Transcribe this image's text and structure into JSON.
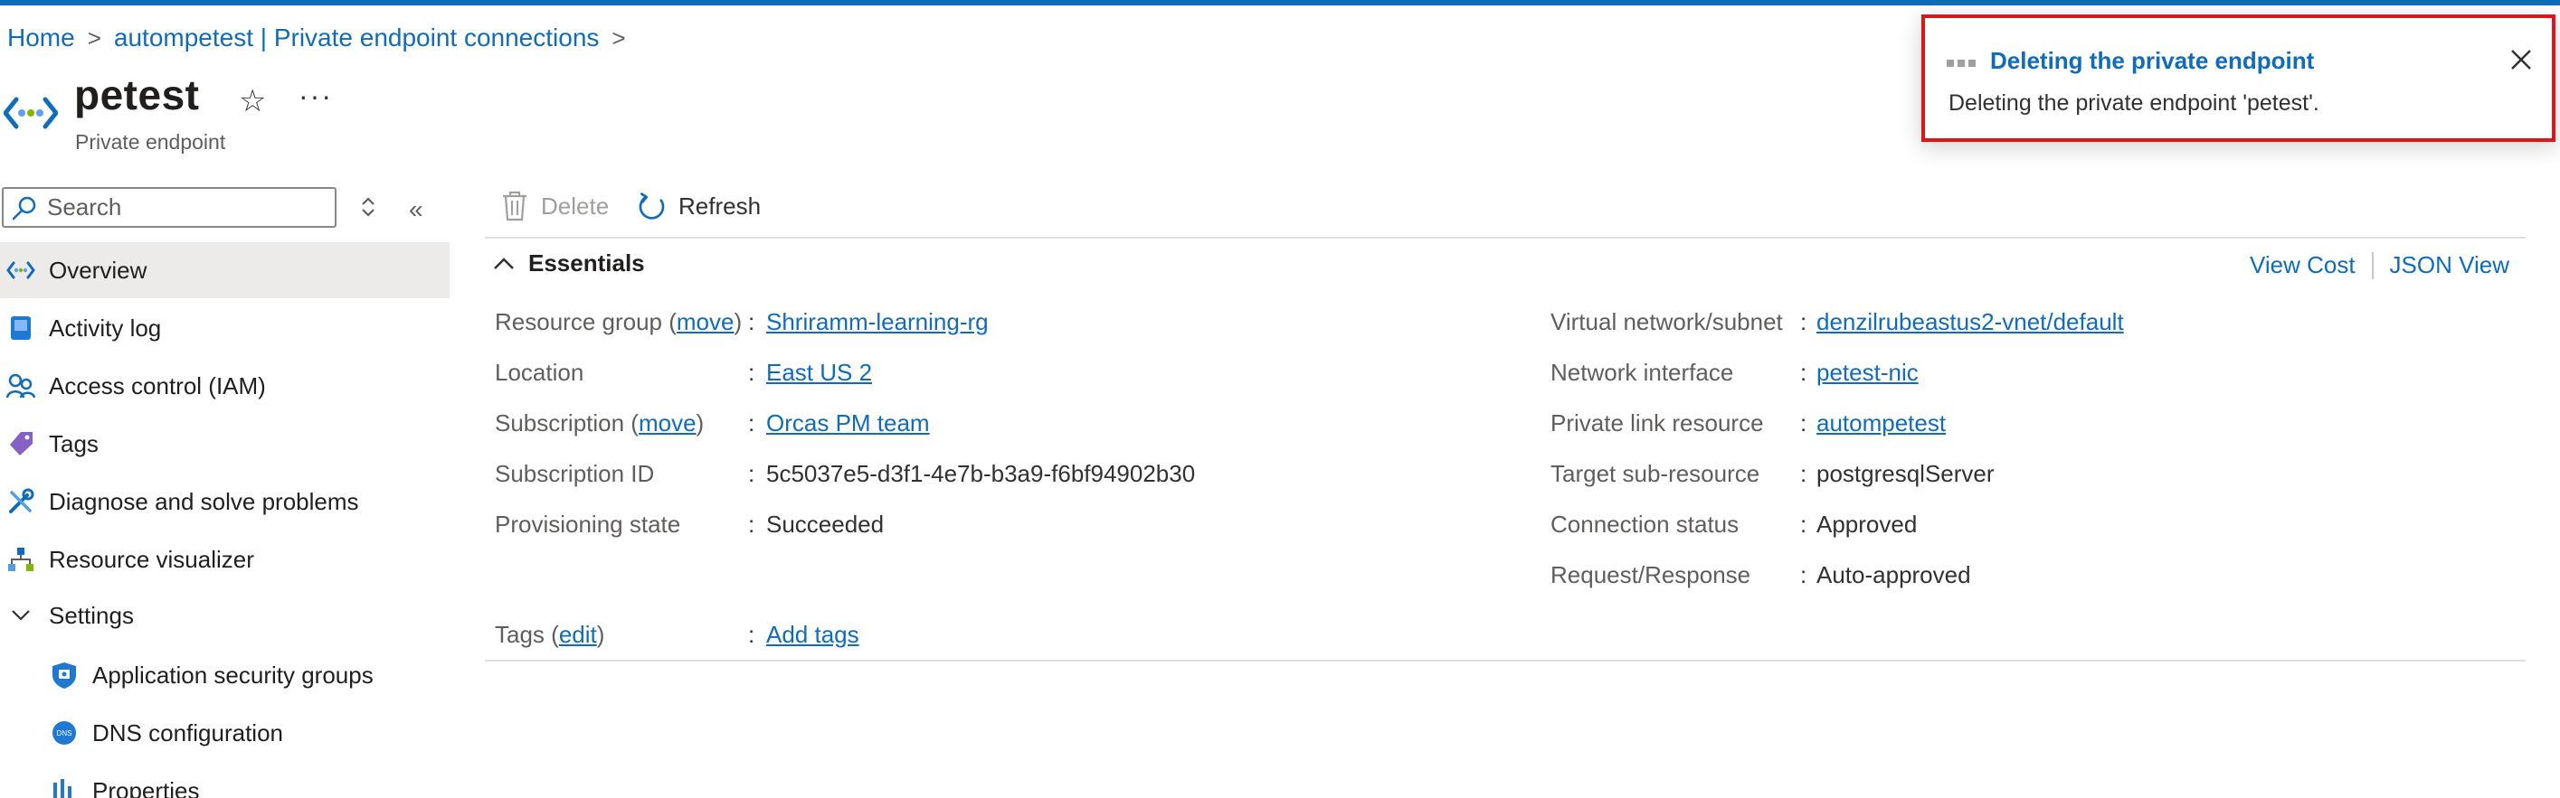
{
  "breadcrumb": {
    "home": "Home",
    "parent": "autompetest | Private endpoint connections",
    "sep": ">"
  },
  "resource": {
    "title": "petest",
    "type": "Private endpoint",
    "more": "···",
    "star": "☆"
  },
  "nav": {
    "search_placeholder": "Search",
    "collapse": "«",
    "items": [
      {
        "label": "Overview"
      },
      {
        "label": "Activity log"
      },
      {
        "label": "Access control (IAM)"
      },
      {
        "label": "Tags"
      },
      {
        "label": "Diagnose and solve problems"
      },
      {
        "label": "Resource visualizer"
      },
      {
        "label": "Settings"
      },
      {
        "label": "Application security groups"
      },
      {
        "label": "DNS configuration"
      },
      {
        "label": "Properties"
      }
    ]
  },
  "toolbar": {
    "delete_label": "Delete",
    "refresh_label": "Refresh"
  },
  "essentials": {
    "title": "Essentials",
    "view_cost": "View Cost",
    "json_view": "JSON View",
    "move": "move",
    "edit": "edit",
    "left": [
      {
        "label": "Resource group",
        "value": "Shriramm-learning-rg"
      },
      {
        "label": "Location",
        "value": "East US 2"
      },
      {
        "label": "Subscription",
        "value": "Orcas PM team"
      },
      {
        "label": "Subscription ID",
        "value": "5c5037e5-d3f1-4e7b-b3a9-f6bf94902b30"
      },
      {
        "label": "Provisioning state",
        "value": "Succeeded"
      }
    ],
    "right": [
      {
        "label": "Virtual network/subnet",
        "value": "denzilrubeastus2-vnet/default"
      },
      {
        "label": "Network interface",
        "value": "petest-nic"
      },
      {
        "label": "Private link resource",
        "value": "autompetest"
      },
      {
        "label": "Target sub-resource",
        "value": "postgresqlServer"
      },
      {
        "label": "Connection status",
        "value": "Approved"
      },
      {
        "label": "Request/Response",
        "value": "Auto-approved"
      }
    ],
    "tags": {
      "label": "Tags",
      "value": "Add tags"
    }
  },
  "notification": {
    "title": "Deleting the private endpoint",
    "message": "Deleting the private endpoint 'petest'."
  },
  "colors": {
    "accent": "#0f6cbd",
    "highlight_border": "#e0141c",
    "selected_bg": "#edebe9"
  }
}
